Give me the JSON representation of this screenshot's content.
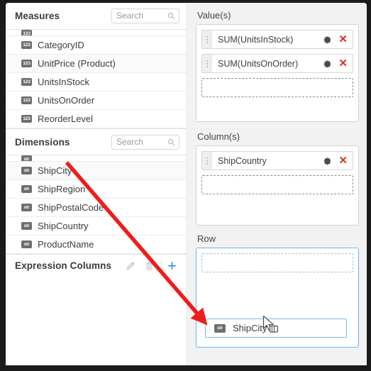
{
  "left_panel": {
    "measures": {
      "title": "Measures",
      "search_placeholder": "Search",
      "search_value": "",
      "search_icon": "search-icon",
      "clipped_top_row": true,
      "fields": [
        {
          "type_icon": "123",
          "label": "CategoryID"
        },
        {
          "type_icon": "123",
          "label": "UnitPrice (Product)"
        },
        {
          "type_icon": "123",
          "label": "UnitsInStock"
        },
        {
          "type_icon": "123",
          "label": "UnitsOnOrder"
        },
        {
          "type_icon": "123",
          "label": "ReorderLevel"
        }
      ]
    },
    "dimensions": {
      "title": "Dimensions",
      "search_placeholder": "Search",
      "search_value": "",
      "search_icon": "search-icon",
      "clipped_top_row": true,
      "fields": [
        {
          "type_icon": "str",
          "label": "ShipCity"
        },
        {
          "type_icon": "str",
          "label": "ShipRegion"
        },
        {
          "type_icon": "str",
          "label": "ShipPostalCode"
        },
        {
          "type_icon": "str",
          "label": "ShipCountry"
        },
        {
          "type_icon": "str",
          "label": "ProductName"
        }
      ]
    },
    "expression_columns": {
      "title": "Expression Columns",
      "edit_icon": "pencil-icon",
      "delete_icon": "trash-icon",
      "add_label": "+"
    }
  },
  "right_panel": {
    "values_zone": {
      "label": "Value(s)",
      "pills": [
        {
          "text": "SUM(UnitsInStock)",
          "settings_icon": "gear-icon",
          "remove_icon": "close-icon"
        },
        {
          "text": "SUM(UnitsOnOrder)",
          "settings_icon": "gear-icon",
          "remove_icon": "close-icon"
        }
      ],
      "drop_slot": true,
      "active": false
    },
    "columns_zone": {
      "label": "Column(s)",
      "pills": [
        {
          "text": "ShipCountry",
          "settings_icon": "gear-icon",
          "remove_icon": "close-icon"
        }
      ],
      "drop_slot": true,
      "active": false
    },
    "row_zone": {
      "label": "Row",
      "pills": [],
      "drop_slot": true,
      "active": true
    }
  },
  "drag": {
    "ghost_label": "ShipCity",
    "ghost_type_icon": "str",
    "cursor_icon": "drag-cursor"
  },
  "annotation": {
    "arrow_color": "#ee1c1c",
    "arrow_from": "ShipCity in Dimensions list",
    "arrow_to": "Row drop zone"
  },
  "colors": {
    "accent_blue": "#2f90e8",
    "drop_active_border": "#70b4ef",
    "remove_red": "#d93025",
    "panel_bg": "#f2f2f2",
    "frame": "#1b1b1b"
  }
}
